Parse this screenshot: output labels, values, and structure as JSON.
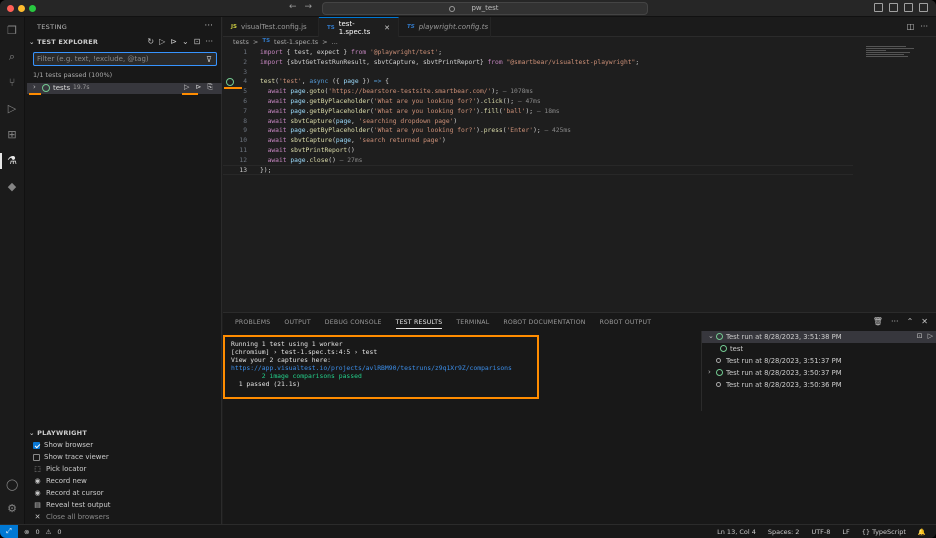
{
  "window": {
    "title": "pw_test",
    "traffic_colors": [
      "#ff5f57",
      "#febc2e",
      "#28c840"
    ]
  },
  "sidebar": {
    "title": "TESTING",
    "explorer_title": "TEST EXPLORER",
    "filter_placeholder": "Filter (e.g. text, !exclude, @tag)",
    "summary": "1/1 tests passed (100%)",
    "test_item": {
      "name": "tests",
      "duration": "19.7s"
    },
    "playwright_title": "PLAYWRIGHT",
    "playwright_items": [
      {
        "label": "Show browser",
        "checked": true,
        "icon": "checkbox-icon"
      },
      {
        "label": "Show trace viewer",
        "checked": false,
        "icon": "checkbox-icon"
      },
      {
        "label": "Pick locator",
        "icon": "pick-locator-icon"
      },
      {
        "label": "Record new",
        "icon": "record-icon"
      },
      {
        "label": "Record at cursor",
        "icon": "record-icon"
      },
      {
        "label": "Reveal test output",
        "icon": "output-icon"
      },
      {
        "label": "Close all browsers",
        "icon": "close-icon"
      }
    ]
  },
  "tabs": [
    {
      "lang": "JS",
      "label": "visualTest.config.js",
      "active": false
    },
    {
      "lang": "TS",
      "label": "test-1.spec.ts",
      "active": true
    },
    {
      "lang": "TS",
      "label": "playwright.config.ts",
      "active": false
    }
  ],
  "breadcrumb": [
    "tests",
    ">",
    "TS",
    "test-1.spec.ts",
    ">",
    "..."
  ],
  "code_lines": [
    {
      "n": "1",
      "html": "<span class='k'>import</span> { test, expect } <span class='k'>from</span> <span class='s'>'@playwright/test'</span>;"
    },
    {
      "n": "2",
      "html": "<span class='k'>import</span> {sbvtGetTestRunResult, sbvtCapture, sbvtPrintReport} <span class='k'>from</span> <span class='s'>\"@smartbear/visualtest-playwright\"</span>;"
    },
    {
      "n": "3",
      "html": ""
    },
    {
      "n": "4",
      "html": "<span class='f'>test</span>(<span class='s'>'test'</span>, <span class='k2'>async</span> ({ <span class='v'>page</span> }) <span class='k2'>=&gt;</span> {"
    },
    {
      "n": "5",
      "html": "  <span class='k'>await</span> <span class='v'>page</span>.<span class='f'>goto</span>(<span class='s'>'https://bearstore-testsite.smartbear.com/'</span>); <span class='lanno'>— 1078ms</span>"
    },
    {
      "n": "6",
      "html": "  <span class='k'>await</span> <span class='v'>page</span>.<span class='f'>getByPlaceholder</span>(<span class='s'>'What are you looking for?'</span>).<span class='f'>click</span>(); <span class='lanno'>— 47ms</span>"
    },
    {
      "n": "7",
      "html": "  <span class='k'>await</span> <span class='v'>page</span>.<span class='f'>getByPlaceholder</span>(<span class='s'>'What are you looking for?'</span>).<span class='f'>fill</span>(<span class='s'>'ball'</span>); <span class='lanno'>— 18ms</span>"
    },
    {
      "n": "8",
      "html": "  <span class='k'>await</span> <span class='f'>sbvtCapture</span>(<span class='v'>page</span>, <span class='s'>'searching dropdown page'</span>)"
    },
    {
      "n": "9",
      "html": "  <span class='k'>await</span> <span class='v'>page</span>.<span class='f'>getByPlaceholder</span>(<span class='s'>'What are you looking for?'</span>).<span class='f'>press</span>(<span class='s'>'Enter'</span>); <span class='lanno'>— 425ms</span>"
    },
    {
      "n": "10",
      "html": "  <span class='k'>await</span> <span class='f'>sbvtCapture</span>(<span class='v'>page</span>, <span class='s'>'search returned page'</span>)"
    },
    {
      "n": "11",
      "html": "  <span class='k'>await</span> <span class='f'>sbvtPrintReport</span>()"
    },
    {
      "n": "12",
      "html": "  <span class='k'>await</span> <span class='v'>page</span>.<span class='f'>close</span>() <span class='lanno'>— 27ms</span>"
    },
    {
      "n": "13",
      "html": "});"
    }
  ],
  "panel": {
    "tabs": [
      "PROBLEMS",
      "OUTPUT",
      "DEBUG CONSOLE",
      "TEST RESULTS",
      "TERMINAL",
      "ROBOT DOCUMENTATION",
      "ROBOT OUTPUT"
    ],
    "active_tab": "TEST RESULTS",
    "output_lines": [
      {
        "text": "Running 1 test using 1 worker",
        "kind": ""
      },
      {
        "text": "[chromium] › test-1.spec.ts:4:5 › test",
        "kind": ""
      },
      {
        "text": "View your 2 captures here:",
        "kind": ""
      },
      {
        "text": "https://app.visualtest.io/projects/avlRBM90/testruns/z9q1Xr9Z/comparisons",
        "kind": "link"
      },
      {
        "text": "        2 image comparisons passed",
        "kind": "ok"
      },
      {
        "text": "  1 passed (21.1s)",
        "kind": ""
      }
    ],
    "runs": [
      {
        "label": "Test run at 8/28/2023, 3:51:38 PM",
        "level": 0,
        "icon": "check",
        "expanded": true,
        "selected": true
      },
      {
        "label": "test",
        "level": 1,
        "icon": "check",
        "expanded": false,
        "selected": false
      },
      {
        "label": "Test run at 8/28/2023, 3:51:37 PM",
        "level": 0,
        "icon": "dot",
        "expanded": false,
        "selected": false
      },
      {
        "label": "Test run at 8/28/2023, 3:50:37 PM",
        "level": 0,
        "icon": "check",
        "collapsed": true,
        "selected": false
      },
      {
        "label": "Test run at 8/28/2023, 3:50:36 PM",
        "level": 0,
        "icon": "dot",
        "expanded": false,
        "selected": false
      }
    ]
  },
  "statusbar": {
    "errors": "0",
    "warnings": "0",
    "right": [
      "Ln 13, Col 4",
      "Spaces: 2",
      "UTF-8",
      "LF",
      "{} TypeScript"
    ]
  },
  "accent": "#0078d4",
  "highlight": "#ff8c00"
}
